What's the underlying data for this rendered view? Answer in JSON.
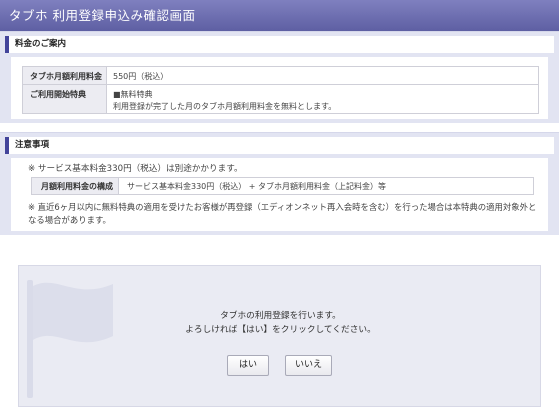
{
  "header": {
    "title": "タブホ  利用登録申込み確認画面"
  },
  "fee_section": {
    "heading": "料金のご案内",
    "rows": [
      {
        "label": "タブホ月額利用料金",
        "value_lines": [
          "550円（税込）"
        ]
      },
      {
        "label": "ご利用開始特典",
        "value_lines": [
          "■無料特典",
          "利用登録が完了した月のタブホ月額利用料金を無料とします。"
        ]
      }
    ]
  },
  "notes_section": {
    "heading": "注意事項",
    "note1": "※ サービス基本料金330円（税込）は別途かかります。",
    "composition": {
      "label": "月額利用料金の構成",
      "value": "サービス基本料金330円（税込） + タブホ月額利用料金（上記料金）等"
    },
    "note2": "※ 直近6ヶ月以内に無料特典の適用を受けたお客様が再登録（エディオンネット再入会時を含む）を行った場合は本特典の適用対象外となる場合があります。"
  },
  "dialog": {
    "line1": "タブホの利用登録を行います。",
    "line2": "よろしければ【はい】をクリックしてください。",
    "yes_label": "はい",
    "no_label": "いいえ",
    "icon": "flag-icon"
  },
  "colors": {
    "title_bar": "#6a6bad",
    "panel_bg": "#e2e4f2",
    "accent": "#43449a"
  }
}
